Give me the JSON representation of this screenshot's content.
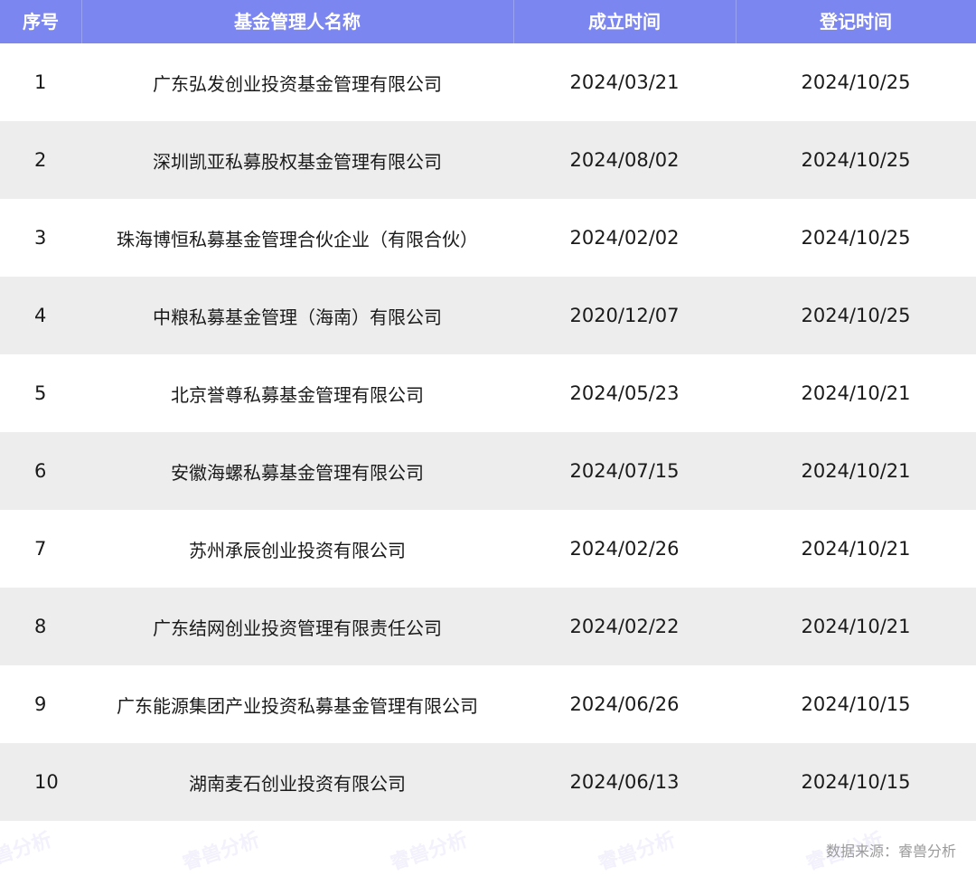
{
  "table": {
    "headers": [
      "序号",
      "基金管理人名称",
      "成立时间",
      "登记时间"
    ],
    "rows": [
      {
        "idx": "1",
        "name": "广东弘发创业投资基金管理有限公司",
        "established": "2024/03/21",
        "registered": "2024/10/25"
      },
      {
        "idx": "2",
        "name": "深圳凯亚私募股权基金管理有限公司",
        "established": "2024/08/02",
        "registered": "2024/10/25"
      },
      {
        "idx": "3",
        "name": "珠海博恒私募基金管理合伙企业（有限合伙）",
        "established": "2024/02/02",
        "registered": "2024/10/25"
      },
      {
        "idx": "4",
        "name": "中粮私募基金管理（海南）有限公司",
        "established": "2020/12/07",
        "registered": "2024/10/25"
      },
      {
        "idx": "5",
        "name": "北京誉尊私募基金管理有限公司",
        "established": "2024/05/23",
        "registered": "2024/10/21"
      },
      {
        "idx": "6",
        "name": "安徽海螺私募基金管理有限公司",
        "established": "2024/07/15",
        "registered": "2024/10/21"
      },
      {
        "idx": "7",
        "name": "苏州承辰创业投资有限公司",
        "established": "2024/02/26",
        "registered": "2024/10/21"
      },
      {
        "idx": "8",
        "name": "广东结网创业投资管理有限责任公司",
        "established": "2024/02/22",
        "registered": "2024/10/21"
      },
      {
        "idx": "9",
        "name": "广东能源集团产业投资私募基金管理有限公司",
        "established": "2024/06/26",
        "registered": "2024/10/15"
      },
      {
        "idx": "10",
        "name": "湖南麦石创业投资有限公司",
        "established": "2024/06/13",
        "registered": "2024/10/15"
      }
    ]
  },
  "footer": {
    "source": "数据来源：睿兽分析"
  },
  "watermark_text": "睿兽分析",
  "colors": {
    "header_bg": "#7c86f0",
    "stripe": "#ededed"
  }
}
